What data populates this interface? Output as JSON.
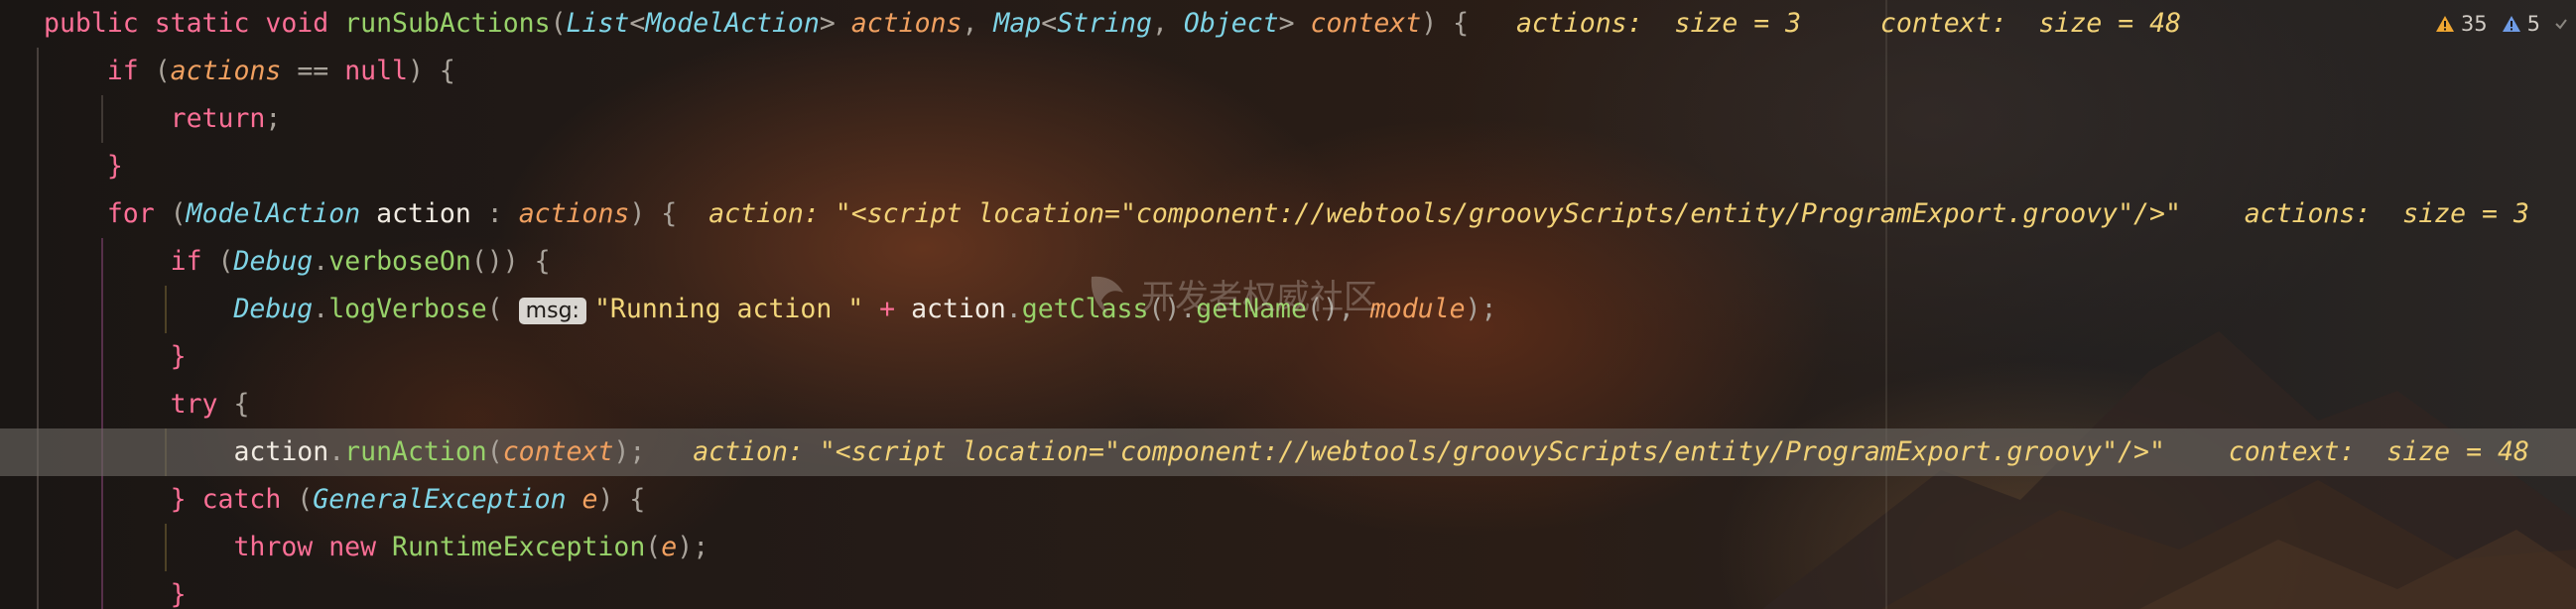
{
  "editor": {
    "lines": [
      {
        "tokens": [
          {
            "t": "public ",
            "c": "kw"
          },
          {
            "t": "static ",
            "c": "kw"
          },
          {
            "t": "void ",
            "c": "kw"
          },
          {
            "t": "runSubActions",
            "c": "fn"
          },
          {
            "t": "(",
            "c": "punc"
          },
          {
            "t": "List",
            "c": "ty"
          },
          {
            "t": "<",
            "c": "punc"
          },
          {
            "t": "ModelAction",
            "c": "ty"
          },
          {
            "t": "> ",
            "c": "punc"
          },
          {
            "t": "actions",
            "c": "par"
          },
          {
            "t": ", ",
            "c": "punc"
          },
          {
            "t": "Map",
            "c": "ty"
          },
          {
            "t": "<",
            "c": "punc"
          },
          {
            "t": "String",
            "c": "ty"
          },
          {
            "t": ", ",
            "c": "punc"
          },
          {
            "t": "Object",
            "c": "ty"
          },
          {
            "t": "> ",
            "c": "punc"
          },
          {
            "t": "context",
            "c": "par"
          },
          {
            "t": ") {",
            "c": "punc"
          },
          {
            "t": "   actions:  size = 3     context:  size = 48",
            "c": "dbg"
          }
        ]
      },
      {
        "tokens": [
          {
            "t": "    ",
            "c": "plain"
          },
          {
            "t": "if ",
            "c": "kw"
          },
          {
            "t": "(",
            "c": "punc"
          },
          {
            "t": "actions",
            "c": "par"
          },
          {
            "t": " == ",
            "c": "punc"
          },
          {
            "t": "null",
            "c": "kw"
          },
          {
            "t": ") {",
            "c": "punc"
          }
        ]
      },
      {
        "tokens": [
          {
            "t": "        ",
            "c": "plain"
          },
          {
            "t": "return",
            "c": "kw"
          },
          {
            "t": ";",
            "c": "punc"
          }
        ]
      },
      {
        "tokens": [
          {
            "t": "    ",
            "c": "plain"
          },
          {
            "t": "}",
            "c": "kw"
          }
        ]
      },
      {
        "tokens": [
          {
            "t": "    ",
            "c": "plain"
          },
          {
            "t": "for ",
            "c": "kw"
          },
          {
            "t": "(",
            "c": "punc"
          },
          {
            "t": "ModelAction",
            "c": "ty"
          },
          {
            "t": " action",
            "c": "plain"
          },
          {
            "t": " : ",
            "c": "punc"
          },
          {
            "t": "actions",
            "c": "par"
          },
          {
            "t": ") {",
            "c": "punc"
          },
          {
            "t": "  action: \"<script location=\"component://webtools/groovyScripts/entity/ProgramExport.groovy\"/>\"    actions:  size = 3",
            "c": "dbg"
          }
        ]
      },
      {
        "tokens": [
          {
            "t": "        ",
            "c": "plain"
          },
          {
            "t": "if ",
            "c": "kw"
          },
          {
            "t": "(",
            "c": "punc"
          },
          {
            "t": "Debug",
            "c": "ty"
          },
          {
            "t": ".",
            "c": "punc"
          },
          {
            "t": "verboseOn",
            "c": "call"
          },
          {
            "t": "()) {",
            "c": "punc"
          }
        ]
      },
      {
        "tokens": [
          {
            "t": "            ",
            "c": "plain"
          },
          {
            "t": "Debug",
            "c": "ty"
          },
          {
            "t": ".",
            "c": "punc"
          },
          {
            "t": "logVerbose",
            "c": "call"
          },
          {
            "t": "( ",
            "c": "punc"
          },
          {
            "t": "msg:",
            "c": "hint"
          },
          {
            "t": "\"Running action \"",
            "c": "str"
          },
          {
            "t": " + ",
            "c": "kw"
          },
          {
            "t": "action",
            "c": "plain"
          },
          {
            "t": ".",
            "c": "punc"
          },
          {
            "t": "getClass",
            "c": "call"
          },
          {
            "t": "().",
            "c": "punc"
          },
          {
            "t": "getName",
            "c": "call"
          },
          {
            "t": "(), ",
            "c": "punc"
          },
          {
            "t": "module",
            "c": "par"
          },
          {
            "t": ");",
            "c": "punc"
          }
        ]
      },
      {
        "tokens": [
          {
            "t": "        ",
            "c": "plain"
          },
          {
            "t": "}",
            "c": "kw"
          }
        ]
      },
      {
        "tokens": [
          {
            "t": "        ",
            "c": "plain"
          },
          {
            "t": "try ",
            "c": "kw"
          },
          {
            "t": "{",
            "c": "punc"
          }
        ]
      },
      {
        "tokens": [
          {
            "t": "            ",
            "c": "plain"
          },
          {
            "t": "action",
            "c": "plain"
          },
          {
            "t": ".",
            "c": "punc"
          },
          {
            "t": "runAction",
            "c": "call"
          },
          {
            "t": "(",
            "c": "punc"
          },
          {
            "t": "context",
            "c": "par"
          },
          {
            "t": ");",
            "c": "punc"
          },
          {
            "t": "   action: \"<script location=\"component://webtools/groovyScripts/entity/ProgramExport.groovy\"/>\"    context:  size = 48",
            "c": "dbg"
          }
        ]
      },
      {
        "tokens": [
          {
            "t": "        ",
            "c": "plain"
          },
          {
            "t": "} ",
            "c": "kw"
          },
          {
            "t": "catch ",
            "c": "kw"
          },
          {
            "t": "(",
            "c": "punc"
          },
          {
            "t": "GeneralException",
            "c": "ty"
          },
          {
            "t": " e",
            "c": "par"
          },
          {
            "t": ") {",
            "c": "punc"
          }
        ]
      },
      {
        "tokens": [
          {
            "t": "            ",
            "c": "plain"
          },
          {
            "t": "throw ",
            "c": "kw"
          },
          {
            "t": "new ",
            "c": "kw"
          },
          {
            "t": "RuntimeException",
            "c": "call"
          },
          {
            "t": "(",
            "c": "punc"
          },
          {
            "t": "e",
            "c": "par"
          },
          {
            "t": ");",
            "c": "punc"
          }
        ]
      },
      {
        "tokens": [
          {
            "t": "        ",
            "c": "plain"
          },
          {
            "t": "}",
            "c": "kw"
          }
        ]
      }
    ],
    "current_line": 9
  },
  "inspections": {
    "warnings_count": "35",
    "weak_warnings_count": "5",
    "warning_icon": "warning-triangle-icon",
    "weak_warning_icon": "info-triangle-icon",
    "warning_color": "#f0a732",
    "weak_warning_color": "#6f9ce6"
  },
  "watermark": {
    "text": "开发者权威社区"
  },
  "colors": {
    "keyword": "#fb6f96",
    "function": "#98d26a",
    "type": "#7fd4e6",
    "parameter": "#f0a060",
    "string": "#f3d77b",
    "debug_value": "#f2d277",
    "execution_line_highlight": "#6c6862"
  }
}
